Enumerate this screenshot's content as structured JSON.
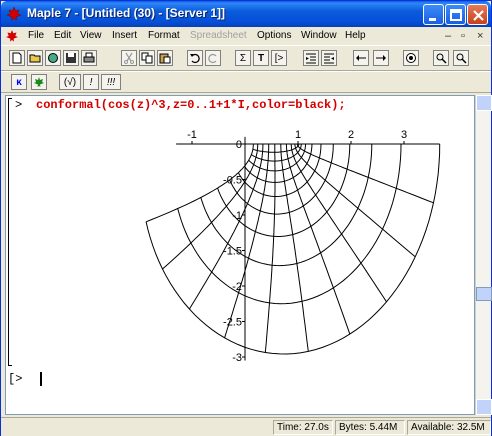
{
  "window": {
    "title": "Maple 7 - [Untitled (30) - [Server 1]]"
  },
  "menu": {
    "items": [
      "File",
      "Edit",
      "View",
      "Insert",
      "Format",
      "Spreadsheet",
      "Options",
      "Window",
      "Help"
    ],
    "disabled": [
      "Spreadsheet"
    ]
  },
  "toolbar": {
    "math_sum": "Σ",
    "text_t": "T",
    "exec": "[>"
  },
  "context_bar": {
    "k_label": "κ",
    "paren": "(√)",
    "bang": "!",
    "bangs": "!!!"
  },
  "worksheet": {
    "prompt": ">",
    "command": "conformal(cos(z)^3,z=0..1+1*I,color=black);",
    "empty_prompt": "[>"
  },
  "chart_data": {
    "type": "conformal-map",
    "x_tick_labels": [
      "-1",
      "0",
      "1",
      "2",
      "3"
    ],
    "y_tick_labels": [
      "0",
      "-0.5",
      "-1",
      "-1.5",
      "-2",
      "-2.5",
      "-3"
    ],
    "xlim": [
      -1.3,
      3.4
    ],
    "ylim": [
      -3.05,
      0.1
    ],
    "function": "cos(z)^3",
    "domain": "z=0..1+1*I",
    "color": "#000000"
  },
  "status": {
    "time": "Time: 27.0s",
    "bytes": "Bytes: 5.44M",
    "available": "Available: 32.5M"
  }
}
